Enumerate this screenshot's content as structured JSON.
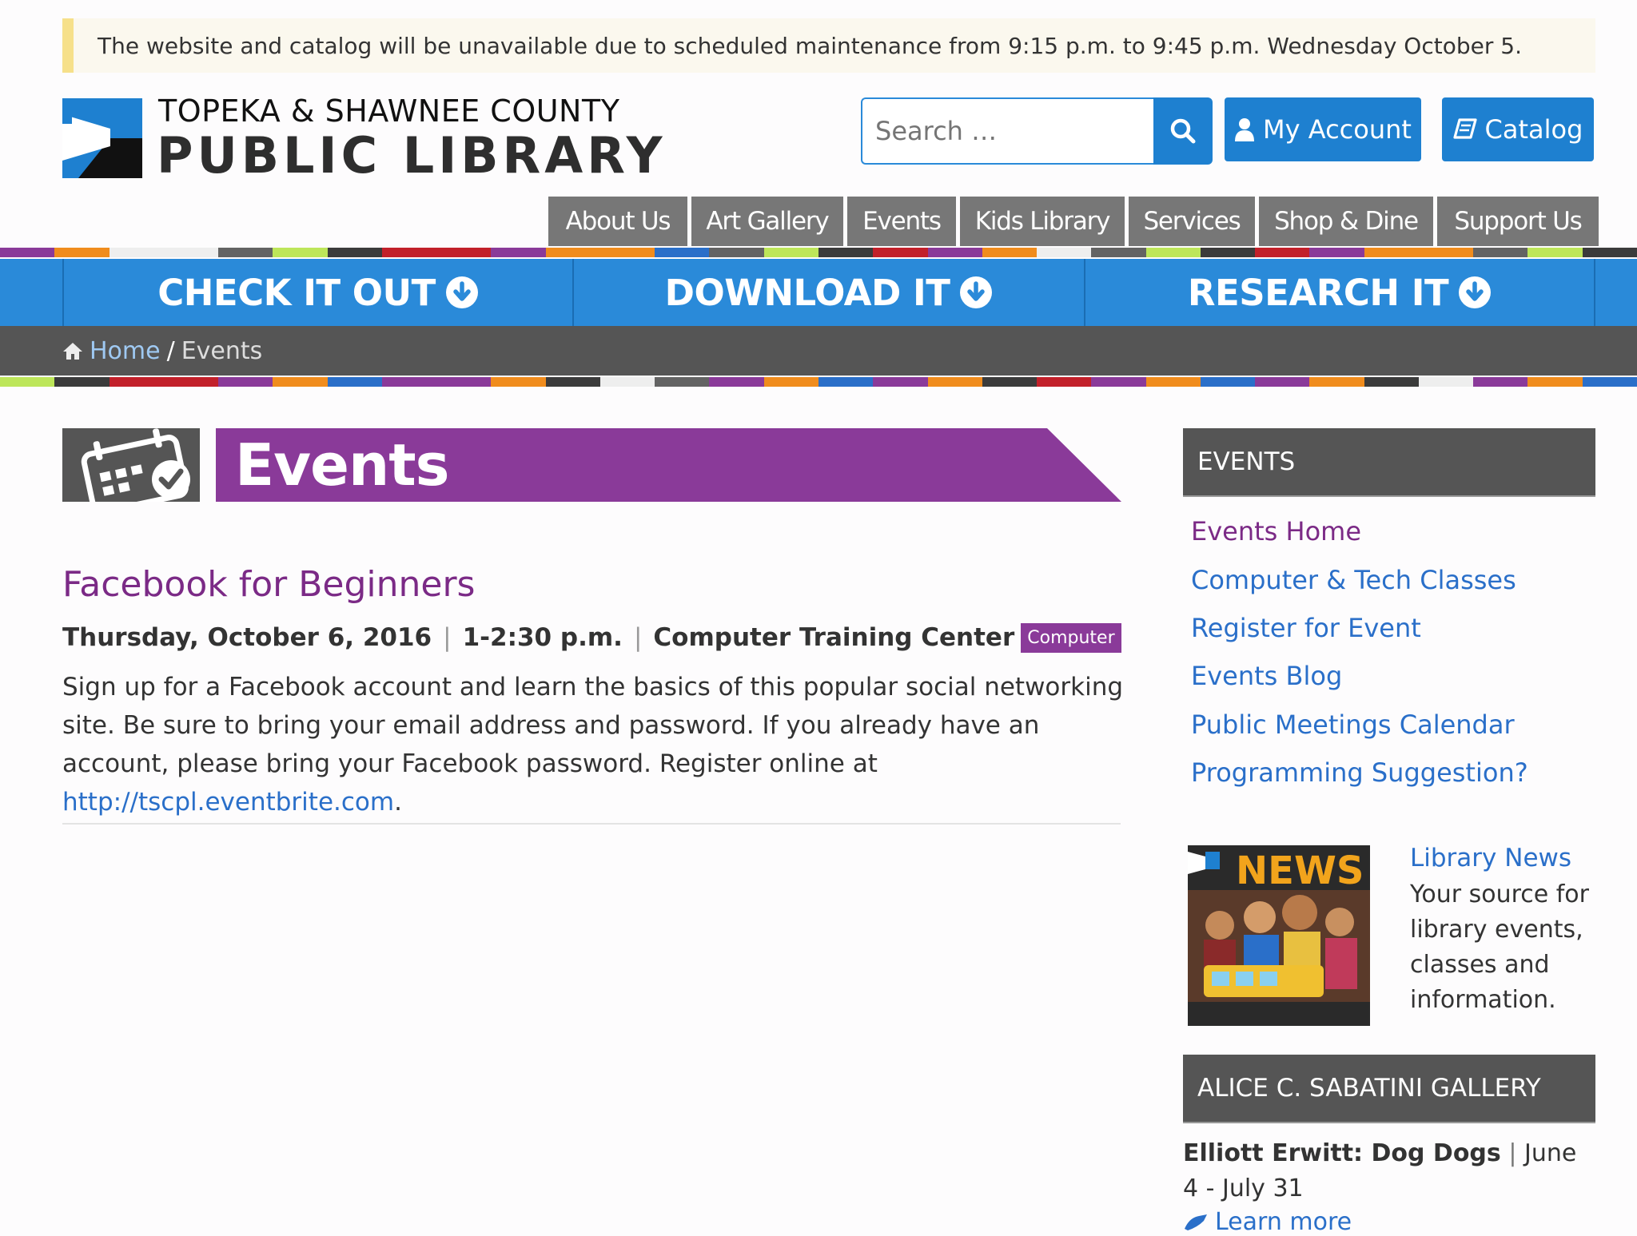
{
  "alert": {
    "text": "The website and catalog will be unavailable due to scheduled maintenance from 9:15 p.m. to 9:45 p.m. Wednesday October 5."
  },
  "logo": {
    "line1": "TOPEKA & SHAWNEE COUNTY",
    "line2": "PUBLIC LIBRARY"
  },
  "header": {
    "search_placeholder": "Search …",
    "my_account_label": "My Account",
    "catalog_label": "Catalog"
  },
  "nav": {
    "items": [
      {
        "label": "About Us"
      },
      {
        "label": "Art Gallery"
      },
      {
        "label": "Events"
      },
      {
        "label": "Kids Library"
      },
      {
        "label": "Services"
      },
      {
        "label": "Shop & Dine"
      },
      {
        "label": "Support Us"
      }
    ]
  },
  "quick_links": [
    {
      "label": "CHECK IT OUT"
    },
    {
      "label": "DOWNLOAD IT"
    },
    {
      "label": "RESEARCH IT"
    }
  ],
  "breadcrumb": {
    "home": "Home",
    "separator": "/",
    "current": "Events"
  },
  "page": {
    "title": "Events"
  },
  "event": {
    "title": "Facebook for Beginners",
    "date": "Thursday, October 6, 2016",
    "separator": "|",
    "time": "1-2:30 p.m.",
    "location": "Computer Training Center",
    "category": "Computer",
    "description": "Sign up for a Facebook account and learn the basics of this popular social networking site. Be sure to bring your email address and password. If you already have an account, please bring your Facebook password. Register online at ",
    "link_text": "http://tscpl.eventbrite.com",
    "description_end": "."
  },
  "sidebar": {
    "events_heading": "EVENTS",
    "links": [
      {
        "label": "Events Home"
      },
      {
        "label": "Computer & Tech Classes"
      },
      {
        "label": "Register for Event"
      },
      {
        "label": "Events Blog"
      },
      {
        "label": "Public Meetings Calendar"
      },
      {
        "label": "Programming Suggestion?"
      }
    ],
    "news": {
      "link": "Library News",
      "description": "Your source for library events, classes and information."
    },
    "gallery_heading": "ALICE C. SABATINI GALLERY",
    "gallery": {
      "exhibit": "Elliott Erwitt: Dog Dogs",
      "separator": "|",
      "dates": "June 4 - July 31",
      "learn_more": "Learn more"
    }
  },
  "colors": {
    "brand_blue": "#1e80d0",
    "quickbar_blue": "#2a8ad9",
    "purple": "#7b2a86",
    "nav_gray": "#777777",
    "dark_gray": "#555555",
    "alert_bar": "#f6e08a",
    "strip": [
      "#8a3a99",
      "#f08c1d",
      "#eeeeee",
      "#636363",
      "#bde65a",
      "#3b3b3b",
      "#c2202a",
      "#8a3a99",
      "#f08c1d",
      "#2a6fc9"
    ]
  }
}
